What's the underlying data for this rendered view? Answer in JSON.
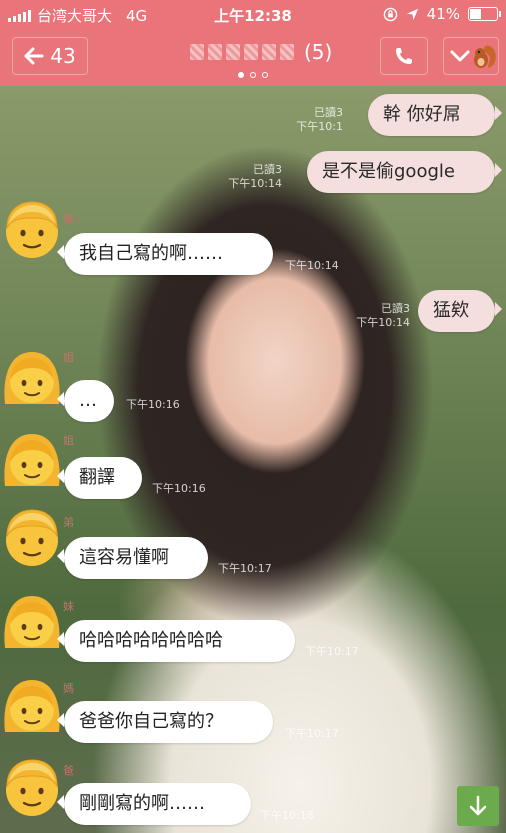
{
  "status": {
    "carrier": "台湾大哥大",
    "network": "4G",
    "time": "上午12:38",
    "battery": "41%",
    "battery_level": 0.41
  },
  "header": {
    "back_count": "43",
    "member_count": "(5)",
    "page_dots": 3,
    "active_dot": 0
  },
  "messages": [
    {
      "side": "out",
      "text": "幹 你好屌",
      "read": "已讀3",
      "time": "下午10:1"
    },
    {
      "side": "out",
      "text": "是不是偷google",
      "read": "已讀3",
      "time": "下午10:14"
    },
    {
      "side": "in",
      "sender": "爸",
      "avatar": "father",
      "text": "我自己寫的啊……",
      "time": "下午10:14"
    },
    {
      "side": "out",
      "text": "猛欸",
      "read": "已讀3",
      "time": "下午10:14"
    },
    {
      "side": "in",
      "sender": "姐",
      "avatar": "sister",
      "text": "…",
      "time": "下午10:16"
    },
    {
      "side": "in",
      "sender": "姐",
      "avatar": "sister",
      "text": "翻譯",
      "time": "下午10:16"
    },
    {
      "side": "in",
      "sender": "弟",
      "avatar": "father",
      "text": "這容易懂啊",
      "time": "下午10:17"
    },
    {
      "side": "in",
      "sender": "妹",
      "avatar": "sister",
      "text": "哈哈哈哈哈哈哈哈",
      "time": "下午10:17"
    },
    {
      "side": "in",
      "sender": "媽",
      "avatar": "sister",
      "text": "爸爸你自己寫的？",
      "time": "下午10:17"
    },
    {
      "side": "in",
      "sender": "爸",
      "avatar": "father",
      "text": "剛剛寫的啊……",
      "time": "下午10:18"
    }
  ],
  "icons": {
    "back": "arrow-left-icon",
    "call": "phone-icon",
    "menu": "chevron-down-icon",
    "scroll": "arrow-down-icon"
  },
  "colors": {
    "header": "#e9757a",
    "outgoing_bubble": "#f4dede",
    "incoming_bubble": "#ffffff",
    "scroll_button": "#6bab4d"
  }
}
